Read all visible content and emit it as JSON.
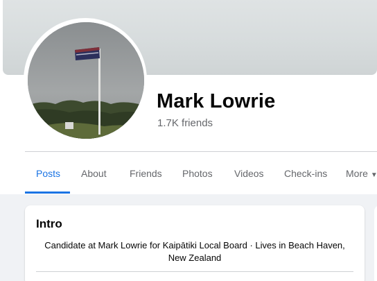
{
  "profile": {
    "name": "Mark Lowrie",
    "friends": "1.7K friends"
  },
  "tabs": [
    {
      "label": "Posts",
      "active": true
    },
    {
      "label": "About"
    },
    {
      "label": "Friends"
    },
    {
      "label": "Photos"
    },
    {
      "label": "Videos"
    },
    {
      "label": "Check-ins"
    },
    {
      "label": "More"
    }
  ],
  "intro": {
    "title": "Intro",
    "bio": "Candidate at Mark Lowrie for Kaipātiki Local Board · Lives in Beach Haven, New Zealand"
  },
  "colors": {
    "accent": "#1b74e4",
    "secondary_text": "#65676b",
    "feed_background": "#f0f2f5"
  }
}
